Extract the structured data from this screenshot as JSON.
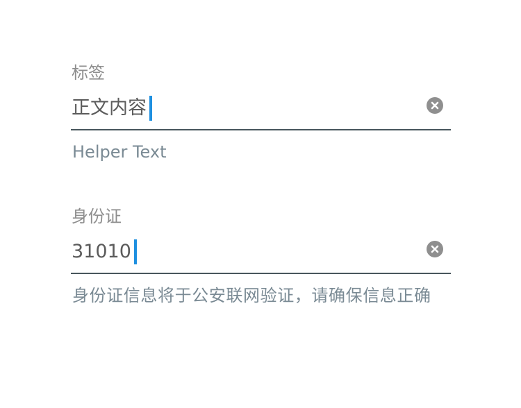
{
  "fields": [
    {
      "label": "标签",
      "value": "正文内容",
      "helper": "Helper Text",
      "clear_icon": "clear-circle-icon"
    },
    {
      "label": "身份证",
      "value": "31010",
      "helper": "身份证信息将于公安联网验证，请确保信息正确",
      "clear_icon": "clear-circle-icon"
    }
  ],
  "colors": {
    "caret": "#1e90e0",
    "underline": "#48565c",
    "label": "#8e8e8e",
    "value": "#5b5b5b",
    "helper": "#7a8a94",
    "clear_icon_bg": "#8f8f8f"
  }
}
